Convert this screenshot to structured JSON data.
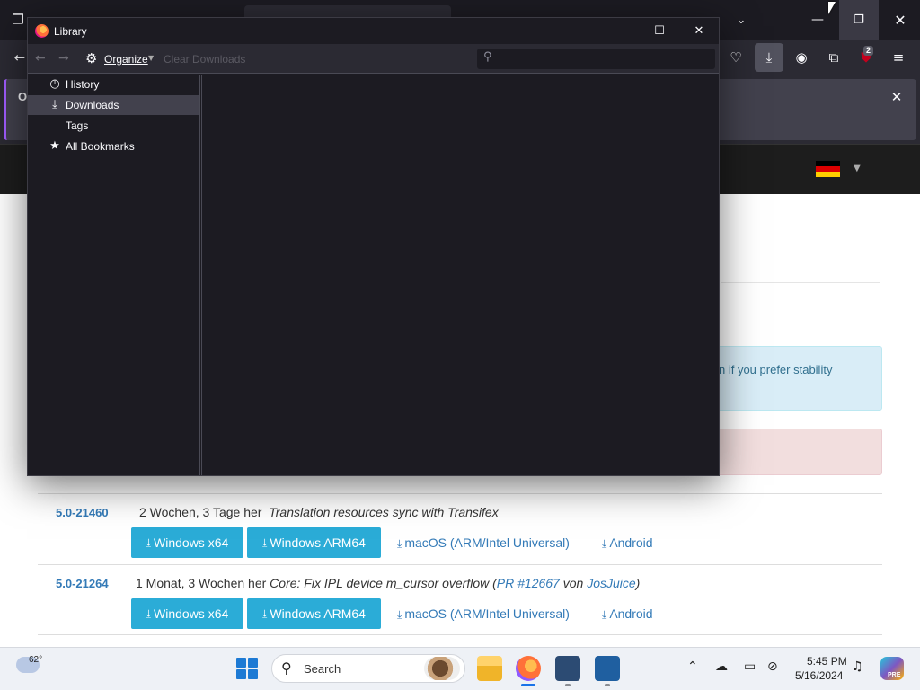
{
  "browser": {
    "icons": {
      "tab_overview": "tab-overview-icon",
      "tab_list": "chevron-down-icon",
      "minimize": "minimize-icon",
      "restore": "restore-icon",
      "close": "close-icon",
      "back": "arrow-left-icon",
      "pocket": "pocket-icon",
      "downloads": "download-icon",
      "account": "account-icon",
      "extensions": "puzzle-icon",
      "ublock": "ublock-icon",
      "menu": "hamburger-icon"
    },
    "ublock_badge": "2",
    "notice_text": "O",
    "accent": "#a15cff"
  },
  "library": {
    "title": "Library",
    "toolbar": {
      "organize": "Organize",
      "clear_downloads": "Clear Downloads",
      "search_placeholder": ""
    },
    "sidebar": [
      {
        "label": "History",
        "icon": "clock-icon",
        "selected": false
      },
      {
        "label": "Downloads",
        "icon": "download-icon",
        "selected": true
      },
      {
        "label": "Tags",
        "icon": "",
        "selected": false
      },
      {
        "label": "All Bookmarks",
        "icon": "star-icon",
        "selected": false
      }
    ]
  },
  "page": {
    "info_alert": "n if you prefer stability",
    "builds": [
      {
        "version": "5.0-21460",
        "age": "2 Wochen, 3 Tage her",
        "message": "Translation resources sync with Transifex",
        "downloads": [
          "Windows x64",
          "Windows ARM64",
          "macOS (ARM/Intel Universal)",
          "Android"
        ]
      },
      {
        "version": "5.0-21264",
        "age": "1 Monat, 3 Wochen her",
        "message_prefix": "Core: Fix IPL device m_cursor overflow (",
        "pr_link": "PR #12667",
        "message_mid": " von ",
        "author_link": "JosJuice",
        "message_suffix": ")",
        "downloads": [
          "Windows x64",
          "Windows ARM64",
          "macOS (ARM/Intel Universal)",
          "Android"
        ]
      }
    ]
  },
  "taskbar": {
    "weather_temp": "62°",
    "search_label": "Search",
    "time": "5:45 PM",
    "date": "5/16/2024",
    "copilot_badge": "PRE"
  }
}
